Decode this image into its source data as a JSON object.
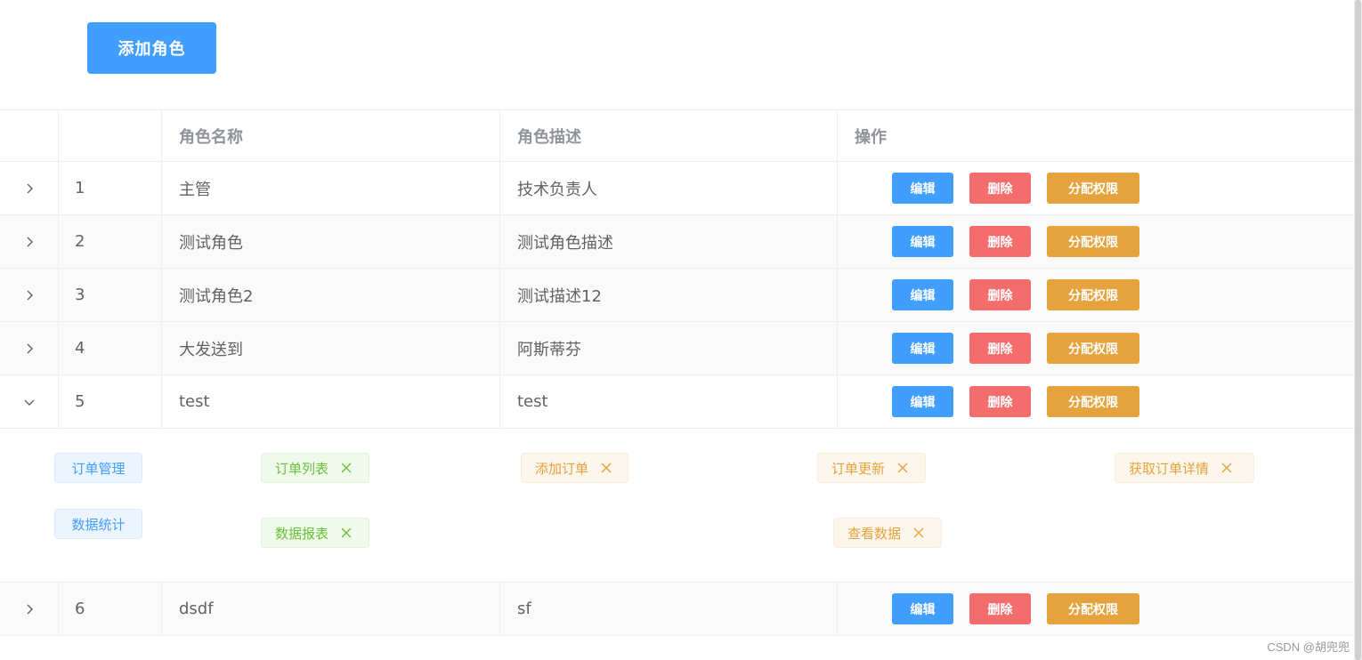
{
  "toolbar": {
    "add_role_label": "添加角色"
  },
  "table": {
    "headers": {
      "name": "角色名称",
      "desc": "角色描述",
      "ops": "操作"
    },
    "op_labels": {
      "edit": "编辑",
      "delete": "删除",
      "assign": "分配权限"
    },
    "rows": [
      {
        "index": "1",
        "name": "主管",
        "desc": "技术负责人",
        "expanded": false
      },
      {
        "index": "2",
        "name": "测试角色",
        "desc": "测试角色描述",
        "expanded": false
      },
      {
        "index": "3",
        "name": "测试角色2",
        "desc": "测试描述12",
        "expanded": false
      },
      {
        "index": "4",
        "name": "大发送到",
        "desc": "阿斯蒂芬",
        "expanded": false
      },
      {
        "index": "5",
        "name": "test",
        "desc": "test",
        "expanded": true
      },
      {
        "index": "6",
        "name": "dsdf",
        "desc": "sf",
        "expanded": false
      }
    ],
    "expanded_rights": {
      "group1": {
        "level1": "订单管理",
        "level2": "订单列表",
        "level3": [
          "添加订单",
          "订单更新",
          "获取订单详情"
        ]
      },
      "group2": {
        "level1": "数据统计",
        "level2": "数据报表",
        "level3": [
          "查看数据"
        ]
      }
    }
  },
  "colors": {
    "primary": "#409eff",
    "danger": "#f56c6c",
    "warning": "#e6a23c",
    "success": "#67c23a"
  },
  "icons": {
    "collapsed": "chevron-right-icon",
    "expanded": "chevron-down-icon",
    "tag_close": "close-icon"
  },
  "watermark": "CSDN @胡兜兜"
}
